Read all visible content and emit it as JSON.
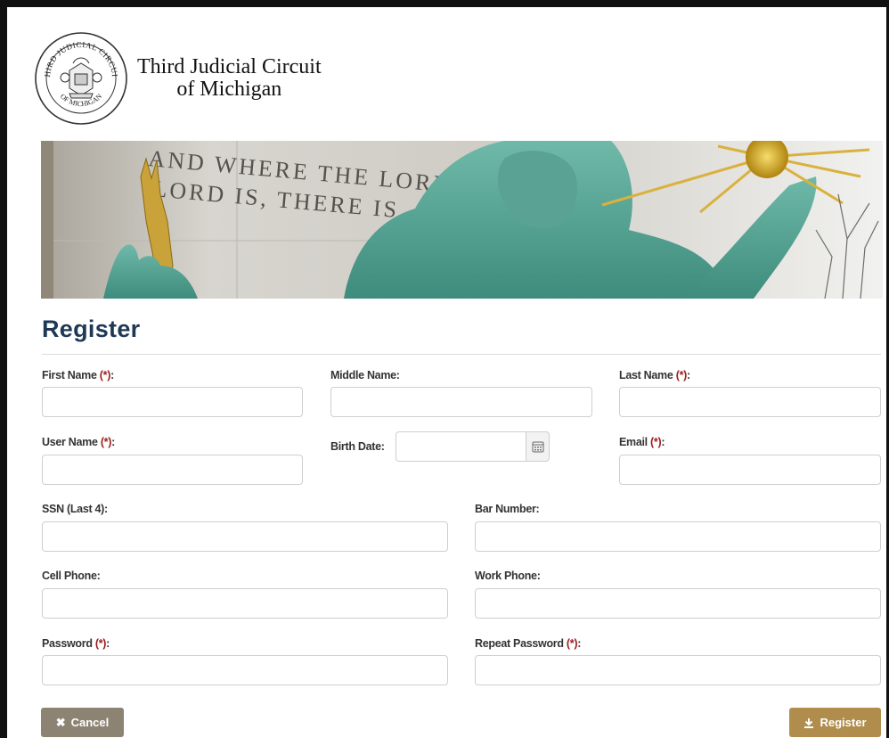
{
  "header": {
    "court_name_line1": "Third Judicial Circuit",
    "court_name_line2": "of Michigan",
    "seal_text_top": "THIRD JUDICIAL CIRCUIT",
    "seal_text_bottom": "OF MICHIGAN"
  },
  "banner": {
    "inscription_line1": "AND WHERE THE LORD IS THAT",
    "inscription_line2": "LORD IS, THERE IS"
  },
  "page": {
    "title": "Register"
  },
  "form": {
    "required_marker": "(*)",
    "first_name": {
      "label": "First Name",
      "value": ""
    },
    "middle_name": {
      "label": "Middle Name:",
      "value": ""
    },
    "last_name": {
      "label": "Last Name",
      "value": ""
    },
    "user_name": {
      "label": "User Name",
      "value": ""
    },
    "birth_date": {
      "label": "Birth Date:",
      "value": ""
    },
    "email": {
      "label": "Email",
      "value": ""
    },
    "ssn": {
      "label": "SSN (Last 4):",
      "value": ""
    },
    "bar_number": {
      "label": "Bar Number:",
      "value": ""
    },
    "cell_phone": {
      "label": "Cell Phone:",
      "value": ""
    },
    "work_phone": {
      "label": "Work Phone:",
      "value": ""
    },
    "password": {
      "label": "Password",
      "value": ""
    },
    "repeat_password": {
      "label": "Repeat Password",
      "value": ""
    },
    "colon": ":"
  },
  "actions": {
    "cancel_label": "Cancel",
    "register_label": "Register"
  },
  "icons": {
    "cancel": "close-icon",
    "register": "download-icon",
    "calendar": "calendar-icon"
  },
  "colors": {
    "title": "#1e3856",
    "required": "#9b1c1c",
    "cancel_button": "#8c8373",
    "register_button": "#b08d4d"
  }
}
